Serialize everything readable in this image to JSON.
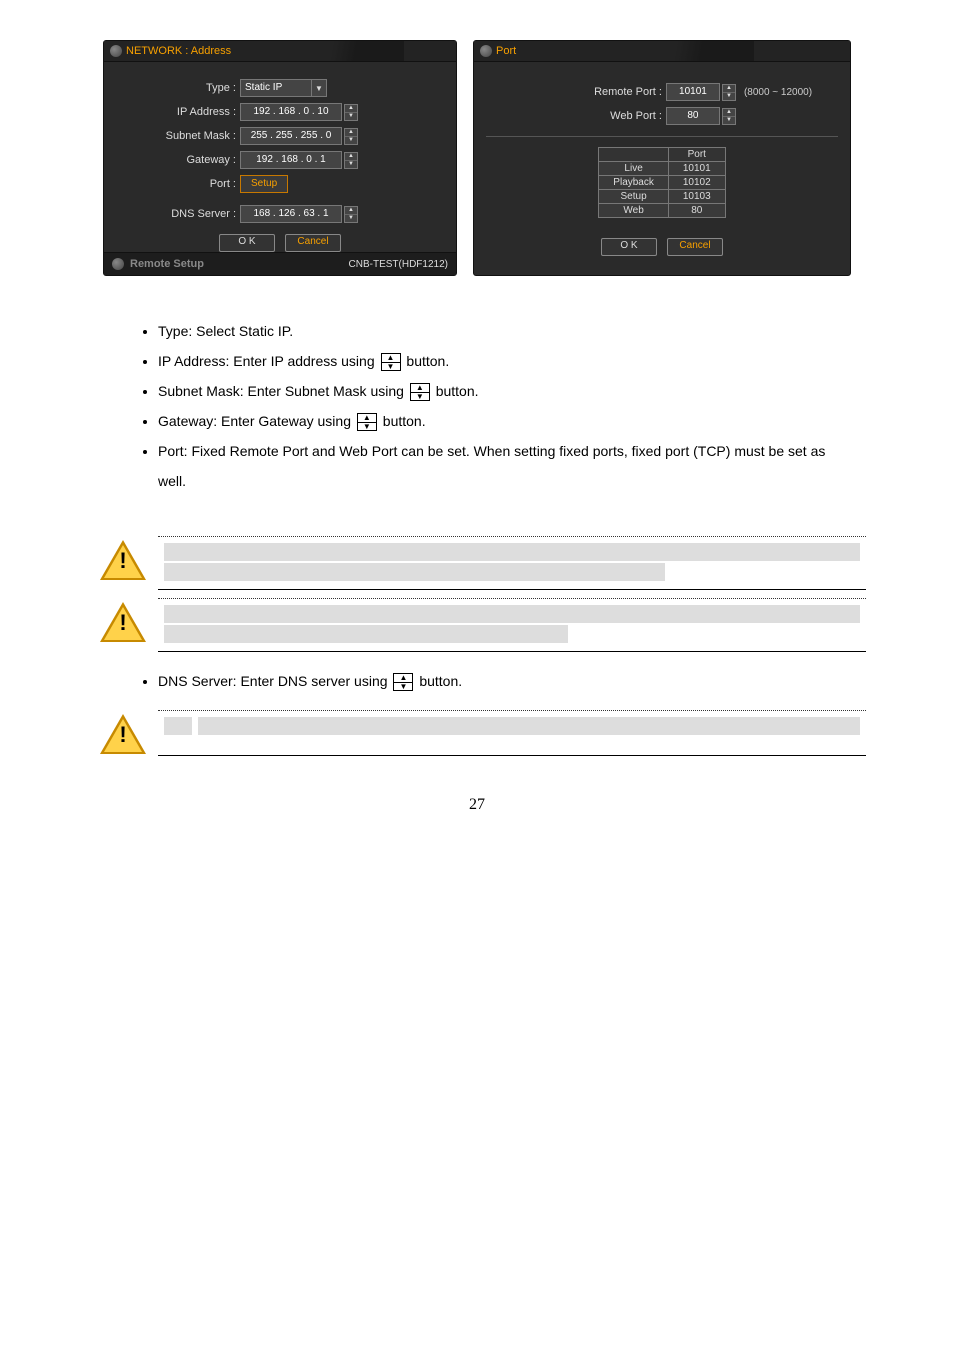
{
  "left_panel": {
    "title": "NETWORK : Address",
    "fields": {
      "type_label": "Type :",
      "type_value": "Static IP",
      "ip_label": "IP Address :",
      "ip_value": "192 . 168 .   0 .  10",
      "subnet_label": "Subnet Mask :",
      "subnet_value": "255 . 255 . 255 .   0",
      "gateway_label": "Gateway :",
      "gateway_value": "192 . 168 .   0 .   1",
      "port_label": "Port :",
      "port_btn": "Setup",
      "dns_label": "DNS Server :",
      "dns_value": "168 . 126 .  63 .   1"
    },
    "ok": "O K",
    "cancel": "Cancel",
    "footer_left": "Remote Setup",
    "footer_right": "CNB-TEST(HDF1212)"
  },
  "right_panel": {
    "title": "Port",
    "remote_label": "Remote Port :",
    "remote_value": "10101",
    "remote_range": "(8000 ~ 12000)",
    "web_label": "Web Port :",
    "web_value": "80",
    "ok": "O K",
    "cancel": "Cancel"
  },
  "chart_data": {
    "type": "table",
    "title": "Port",
    "columns": [
      "",
      "Port"
    ],
    "rows": [
      [
        "Live",
        "10101"
      ],
      [
        "Playback",
        "10102"
      ],
      [
        "Setup",
        "10103"
      ],
      [
        "Web",
        "80"
      ]
    ]
  },
  "bullets": {
    "b1_pre": "Type: Select Static IP.",
    "b2_pre": "IP Address: Enter IP address using",
    "b2_post": " button.",
    "b3_pre": "Subnet Mask: Enter Subnet Mask using",
    "b3_post": " button.",
    "b4_pre": "Gateway: Enter Gateway using",
    "b4_post": " button.",
    "b5": "Port: Fixed Remote Port and Web Port can be set. When setting fixed ports, fixed port (TCP) must be set as well."
  },
  "bullet_dns_pre": "DNS Server: Enter DNS server using",
  "bullet_dns_post": " button.",
  "page_number": "27"
}
